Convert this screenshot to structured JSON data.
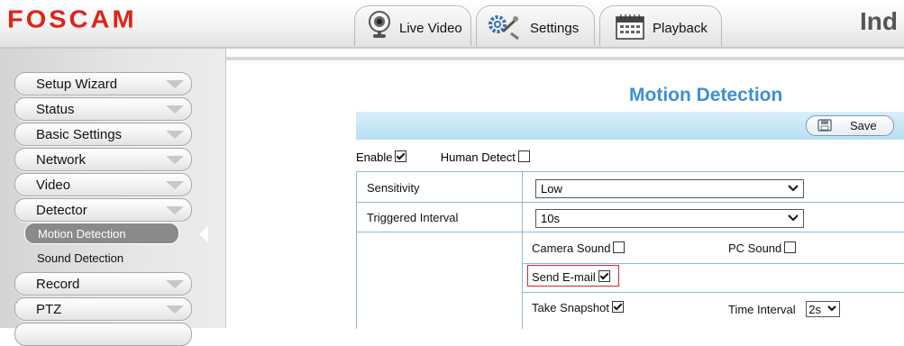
{
  "header": {
    "logo": "FOSCAM",
    "brand_right": "Ind",
    "tabs": [
      {
        "label": "Live Video",
        "icon": "webcam-icon"
      },
      {
        "label": "Settings",
        "icon": "gears-icon"
      },
      {
        "label": "Playback",
        "icon": "calendar-icon"
      }
    ]
  },
  "sidebar": {
    "items": [
      {
        "label": "Setup Wizard"
      },
      {
        "label": "Status"
      },
      {
        "label": "Basic Settings"
      },
      {
        "label": "Network"
      },
      {
        "label": "Video"
      },
      {
        "label": "Detector"
      }
    ],
    "sub_items": [
      {
        "label": "Motion Detection",
        "active": true
      },
      {
        "label": "Sound Detection",
        "active": false
      }
    ],
    "items_after": [
      {
        "label": "Record"
      },
      {
        "label": "PTZ"
      }
    ]
  },
  "main": {
    "title": "Motion Detection",
    "save_label": "Save",
    "enable_label": "Enable",
    "enable_checked": true,
    "human_detect_label": "Human Detect",
    "human_detect_checked": false,
    "sensitivity_label": "Sensitivity",
    "sensitivity_value": "Low",
    "triggered_interval_label": "Triggered Interval",
    "triggered_interval_value": "10s",
    "camera_sound_label": "Camera Sound",
    "camera_sound_checked": false,
    "pc_sound_label": "PC Sound",
    "pc_sound_checked": false,
    "send_email_label": "Send E-mail",
    "send_email_checked": true,
    "take_snapshot_label": "Take Snapshot",
    "take_snapshot_checked": true,
    "time_interval_label": "Time Interval",
    "time_interval_value": "2s"
  },
  "colors": {
    "logo": "#e0231a",
    "title": "#3d8fd8",
    "toolbar": "#c4e5f6",
    "highlight_border": "#cc2a2a"
  }
}
